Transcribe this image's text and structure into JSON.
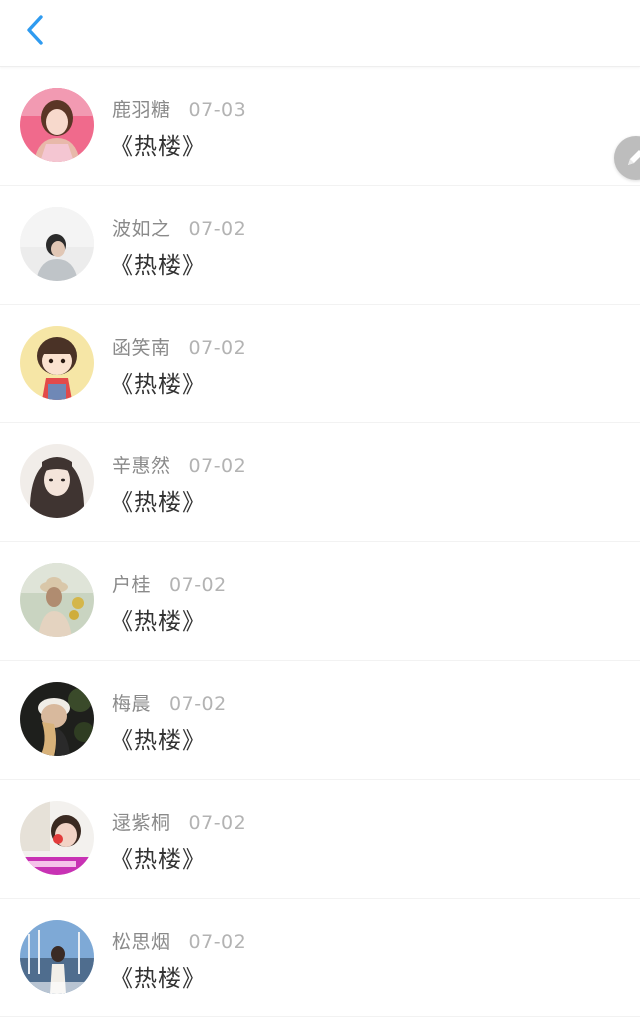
{
  "header": {
    "back_icon": "chevron-left-icon",
    "accent_color": "#2f9bf0"
  },
  "edit_button": {
    "icon": "pencil-icon"
  },
  "items": [
    {
      "name": "鹿羽糖",
      "date": "07-03",
      "title": "《热楼》",
      "avatar_icon": "user-avatar-image"
    },
    {
      "name": "波如之",
      "date": "07-02",
      "title": "《热楼》",
      "avatar_icon": "user-avatar-image"
    },
    {
      "name": "函笑南",
      "date": "07-02",
      "title": "《热楼》",
      "avatar_icon": "user-avatar-image"
    },
    {
      "name": "辛惠然",
      "date": "07-02",
      "title": "《热楼》",
      "avatar_icon": "user-avatar-image"
    },
    {
      "name": "户桂",
      "date": "07-02",
      "title": "《热楼》",
      "avatar_icon": "user-avatar-image"
    },
    {
      "name": "梅晨",
      "date": "07-02",
      "title": "《热楼》",
      "avatar_icon": "user-avatar-image"
    },
    {
      "name": "逯紫桐",
      "date": "07-02",
      "title": "《热楼》",
      "avatar_icon": "user-avatar-image"
    },
    {
      "name": "松思烟",
      "date": "07-02",
      "title": "《热楼》",
      "avatar_icon": "user-avatar-image"
    }
  ]
}
